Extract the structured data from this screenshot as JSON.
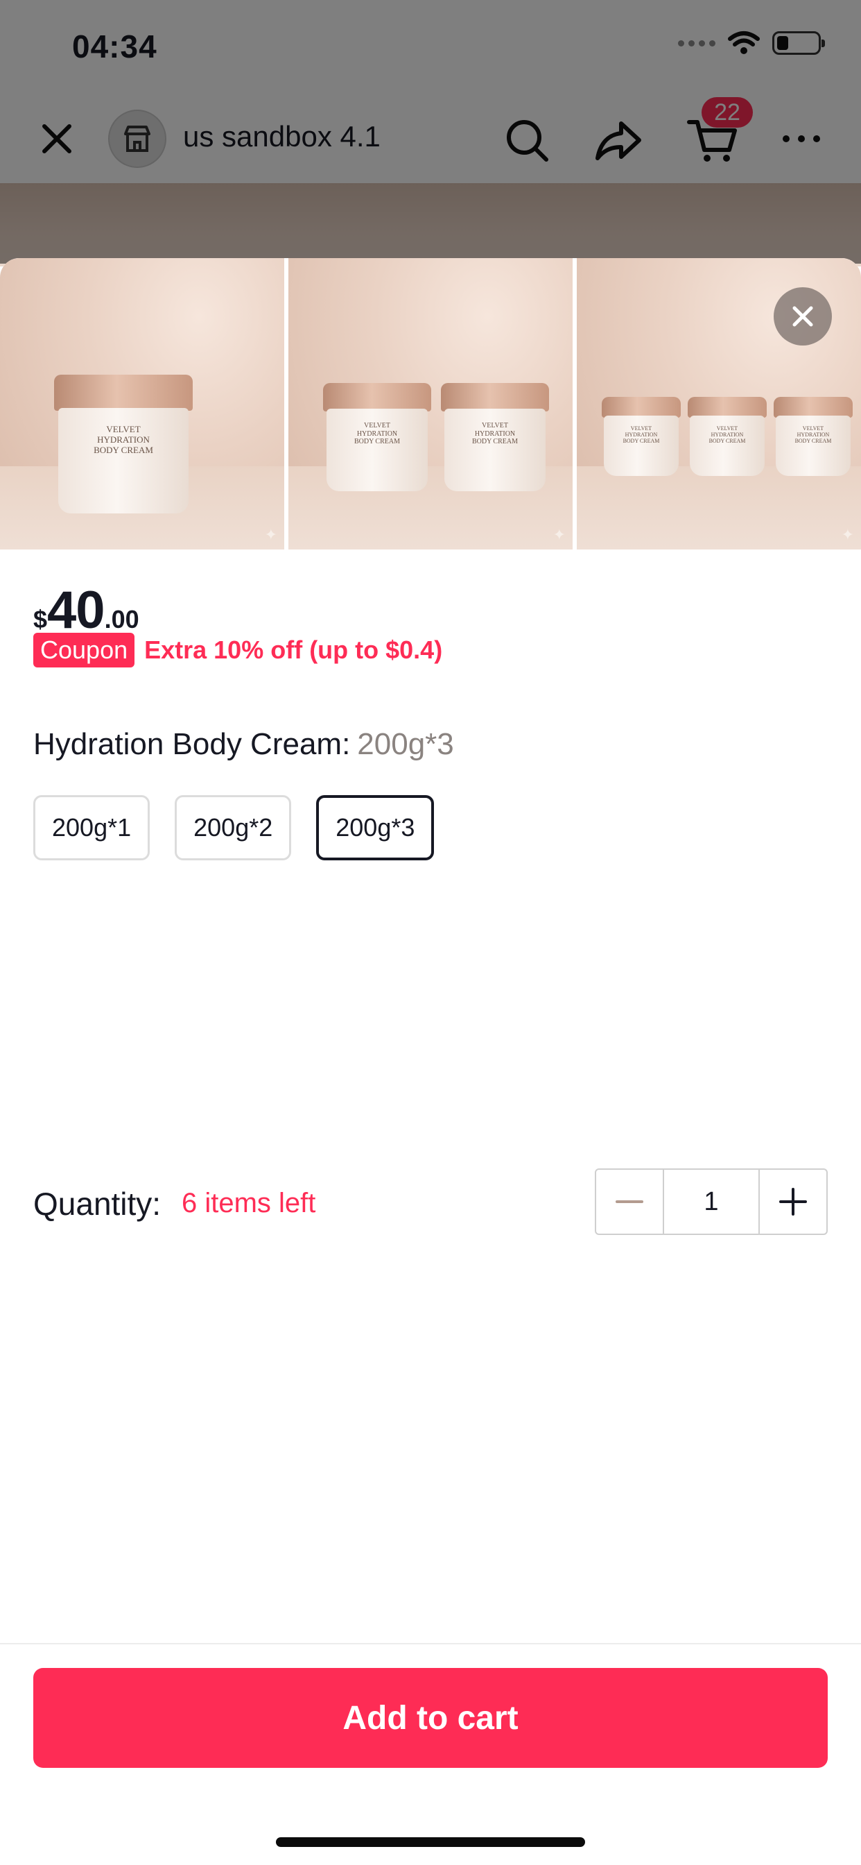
{
  "status_bar": {
    "time": "04:34"
  },
  "nav": {
    "shop_name": "us sandbox 4.1",
    "cart_count": "22"
  },
  "gallery": {
    "images": [
      {
        "name": "product-image-single-jar",
        "jar_label": [
          "VELVET",
          "HYDRATION",
          "BODY CREAM"
        ]
      },
      {
        "name": "product-image-two-jars",
        "jar_label": [
          "VELVET",
          "HYDRATION",
          "BODY CREAM"
        ]
      },
      {
        "name": "product-image-three-jars",
        "jar_label": [
          "VELVET",
          "HYDRATION",
          "BODY CREAM"
        ]
      }
    ]
  },
  "price": {
    "currency": "$",
    "integer": "40",
    "decimal": ".00"
  },
  "coupon": {
    "tag": "Coupon",
    "text": "Extra 10% off (up to $0.4)"
  },
  "variant": {
    "label": "Hydration Body Cream:",
    "selected": "200g*3",
    "options": [
      "200g*1",
      "200g*2",
      "200g*3"
    ]
  },
  "quantity": {
    "label": "Quantity:",
    "stock_note": "6 items left",
    "value": "1"
  },
  "cta": {
    "add_to_cart": "Add to cart"
  },
  "colors": {
    "accent": "#fe2c55",
    "text": "#161823",
    "muted": "#8a8380"
  }
}
